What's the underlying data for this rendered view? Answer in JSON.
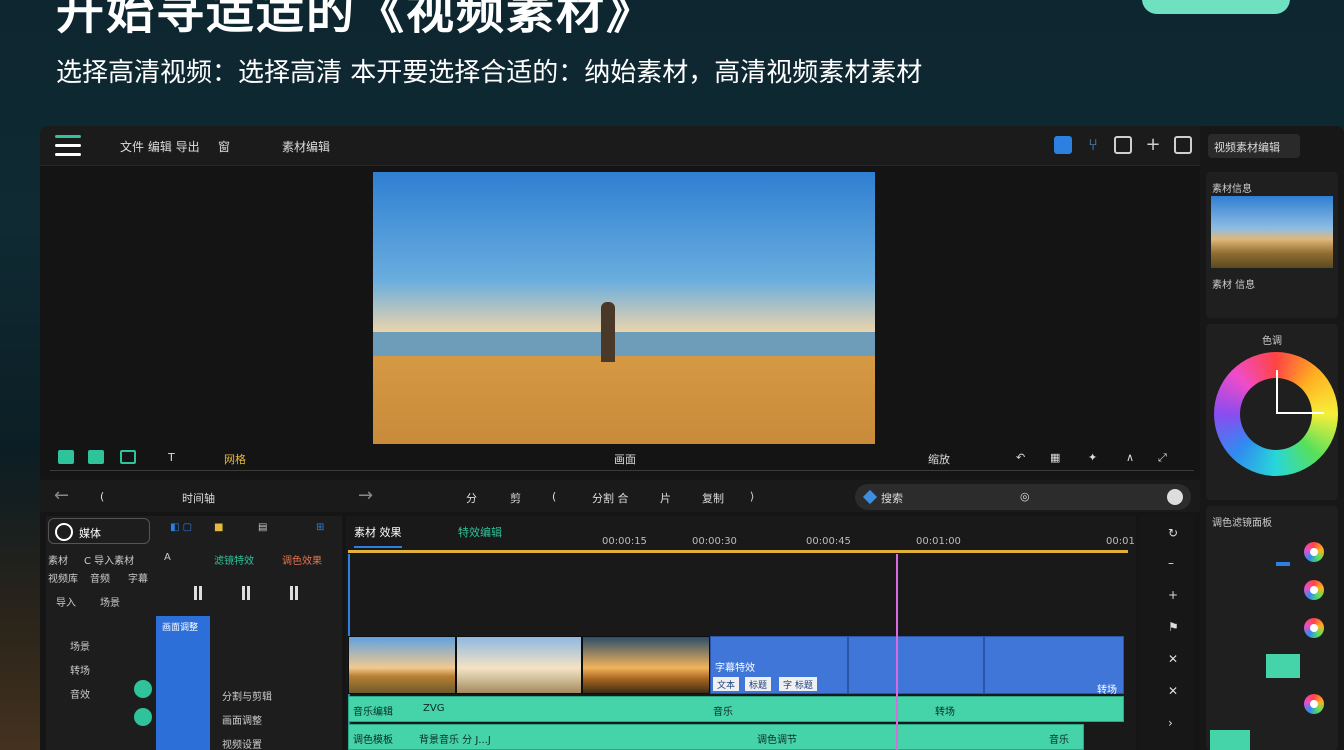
{
  "hero": {
    "headline": "开始寻适适的《视频素材》",
    "subline": "选择高清视频：选择高清 本开要选择合适的：纳始素材，高清视频素材素材"
  },
  "app": {
    "topbar": {
      "menu_1": "文件 编辑 导出",
      "menu_2": "窗",
      "menu_3": "素材编辑"
    },
    "toolbar": {
      "text_tool": "T",
      "grid_tool": "网格",
      "center_label": "画面",
      "right_label": "缩放"
    },
    "nav": {
      "label_1": "(",
      "label_2": "时间轴",
      "label_3": "分",
      "label_4": "剪",
      "label_5": "(",
      "label_6": "分割 合",
      "label_7": "片",
      "label_8": "复制",
      "search_label": "搜索"
    },
    "left_panel": {
      "chip_label": "媒体",
      "row1": [
        "素材",
        "C 导入素材",
        "A",
        "滤镜特效",
        "调色效果"
      ],
      "row2": [
        "视频库",
        "音频",
        "字幕"
      ],
      "row3": [
        "导入",
        "场景"
      ],
      "blue_label": "画面调整",
      "list_left": [
        "场景",
        "转场",
        "音效"
      ],
      "list_right": [
        "分割与剪辑",
        "画面调整",
        "视频设置"
      ]
    },
    "timeline": {
      "tab_1": "素材 效果",
      "tab_2": "特效编辑",
      "marks": [
        "00:00:15",
        "00:00:30",
        "00:00:45",
        "00:01:00",
        "00:01"
      ],
      "blue_label": "字幕特效",
      "chips": [
        "文本",
        "标题",
        "字 标题"
      ],
      "blue_end": "转场",
      "teal_1": [
        "音乐编辑",
        "ZVG",
        "音乐",
        "转场"
      ],
      "teal_2": [
        "调色模板",
        "背景音乐 分 J...J",
        "调色调节",
        "音乐"
      ]
    },
    "right_panel": {
      "button": "视频素材编辑",
      "card1_title": "素材信息",
      "card1_meta": "素材 信息",
      "card2_title": "色调",
      "card3_title": "调色滤镜面板"
    }
  }
}
